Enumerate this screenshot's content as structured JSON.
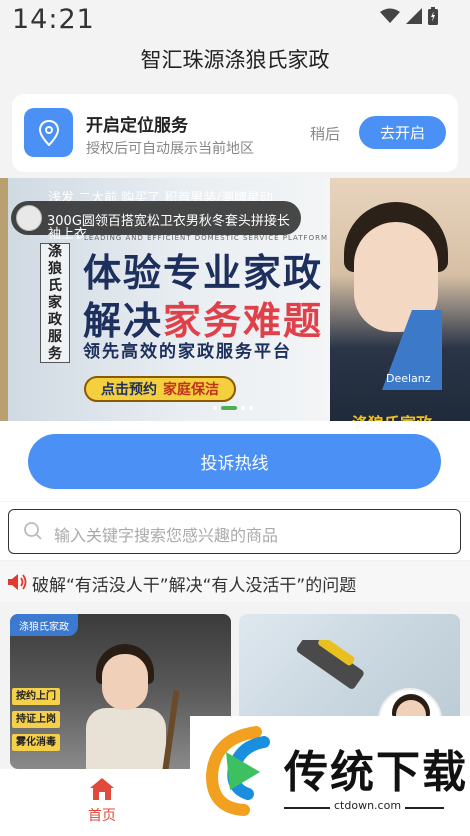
{
  "status_bar": {
    "time": "14:21"
  },
  "app_title": "智汇珠源涤狼氏家政",
  "location_card": {
    "title": "开启定位服务",
    "subtitle": "授权后可自动展示当前地区",
    "later_label": "稍后",
    "enable_label": "去开启"
  },
  "banner": {
    "notice_lines": [
      "浅发 二大前 购买了 积首男装/潮牌星动",
      "300G圆领百搭宽松卫衣男秋冬套头拼接长",
      "袖上衣"
    ],
    "vertical_text": [
      "涤",
      "狼",
      "氏",
      "家",
      "政",
      "服",
      "务"
    ],
    "small_en": "LEADING AND EFFICIENT DOMESTIC SERVICE PLATFORM",
    "headline_1": "体验专业家政",
    "headline_2_a": "解决",
    "headline_2_b": "家务难题",
    "subline": "领先高效的家政服务平台",
    "cta_a": "点击预约",
    "cta_b": "家庭保洁",
    "logo_text": "Deelanz",
    "bottom_text": "涤狼氏家政",
    "active_slide": 1,
    "slide_count": 4
  },
  "complaint_button": "投诉热线",
  "search": {
    "placeholder": "输入关键字搜索您感兴趣的商品"
  },
  "notice": "破解“有活没人干”解决“有人没活干”的问题",
  "cards": [
    {
      "tag": "涤狼氏家政",
      "labels": [
        "按约上门",
        "持证上岗",
        "雾化消毒"
      ]
    },
    {}
  ],
  "bottom_nav": {
    "home_label": "首页"
  },
  "watermark": {
    "title": "传统下载",
    "domain": "ctdown.com"
  },
  "colors": {
    "accent": "#4a90f5",
    "home_active": "#e04a3a",
    "banner_cta": "#f4d03f"
  }
}
